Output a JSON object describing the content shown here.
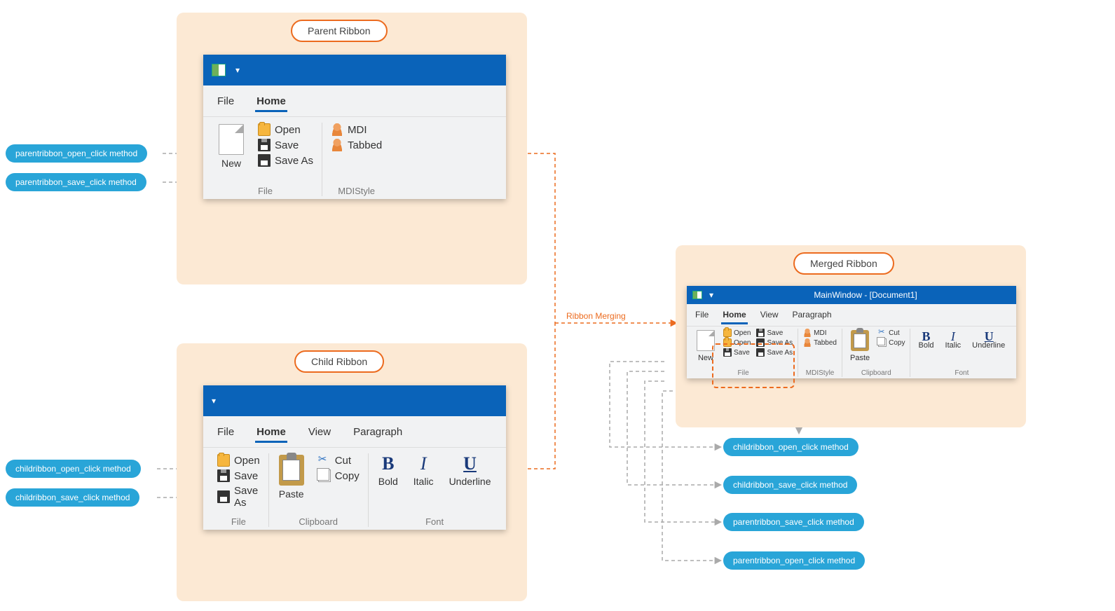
{
  "labels": {
    "parent_title": "Parent Ribbon",
    "child_title": "Child Ribbon",
    "merged_title": "Merged Ribbon",
    "merge_arrow": "Ribbon Merging"
  },
  "methods": {
    "parent_open": "parentribbon_open_click method",
    "parent_save": "parentribbon_save_click method",
    "child_open": "childribbon_open_click method",
    "child_save": "childribbon_save_click method"
  },
  "parent": {
    "tabs": {
      "file": "File",
      "home": "Home"
    },
    "btn_new": "New",
    "btn_open": "Open",
    "btn_save": "Save",
    "btn_saveas": "Save As",
    "btn_mdi": "MDI",
    "btn_tabbed": "Tabbed",
    "grp_file": "File",
    "grp_mdi": "MDIStyle"
  },
  "child": {
    "tabs": {
      "file": "File",
      "home": "Home",
      "view": "View",
      "para": "Paragraph"
    },
    "btn_open": "Open",
    "btn_save": "Save",
    "btn_saveas": "Save As",
    "btn_paste": "Paste",
    "btn_cut": "Cut",
    "btn_copy": "Copy",
    "btn_bold": "Bold",
    "btn_italic": "Italic",
    "btn_uline": "Underline",
    "grp_file": "File",
    "grp_clip": "Clipboard",
    "grp_font": "Font"
  },
  "merged": {
    "wintitle": "MainWindow - [Document1]",
    "tabs": {
      "file": "File",
      "home": "Home",
      "view": "View",
      "para": "Paragraph"
    },
    "btn_new": "New",
    "btn_open": "Open",
    "btn_save": "Save",
    "btn_saveas": "Save As",
    "btn_mdi": "MDI",
    "btn_tabbed": "Tabbed",
    "btn_paste": "Paste",
    "btn_cut": "Cut",
    "btn_copy": "Copy",
    "btn_bold": "Bold",
    "btn_italic": "Italic",
    "btn_uline": "Underline",
    "grp_file": "File",
    "grp_mdi": "MDIStyle",
    "grp_clip": "Clipboard",
    "grp_font": "Font"
  }
}
